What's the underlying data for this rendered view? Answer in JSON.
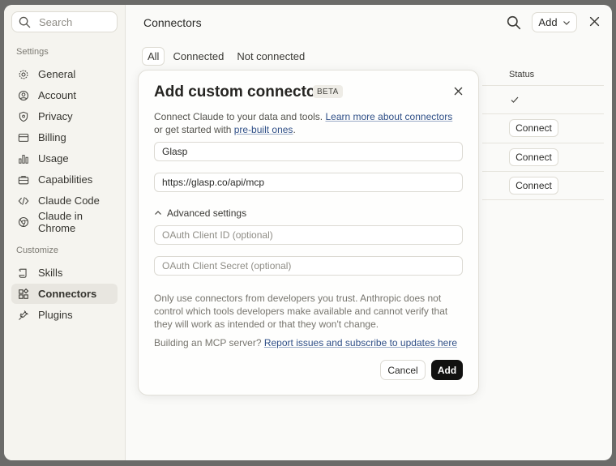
{
  "sidebar": {
    "search_placeholder": "Search",
    "settings_heading": "Settings",
    "settings_items": [
      {
        "label": "General",
        "icon": "gear-icon"
      },
      {
        "label": "Account",
        "icon": "user-circle-icon"
      },
      {
        "label": "Privacy",
        "icon": "shield-icon"
      },
      {
        "label": "Billing",
        "icon": "credit-card-icon"
      },
      {
        "label": "Usage",
        "icon": "bar-chart-icon"
      },
      {
        "label": "Capabilities",
        "icon": "briefcase-icon"
      },
      {
        "label": "Claude Code",
        "icon": "code-icon"
      },
      {
        "label": "Claude in Chrome",
        "icon": "globe-icon"
      }
    ],
    "customize_heading": "Customize",
    "customize_items": [
      {
        "label": "Skills",
        "icon": "scroll-icon"
      },
      {
        "label": "Connectors",
        "icon": "blocks-icon",
        "active": true
      },
      {
        "label": "Plugins",
        "icon": "plug-icon"
      }
    ]
  },
  "main": {
    "title": "Connectors",
    "add_label": "Add",
    "tabs": [
      {
        "label": "All",
        "active": true
      },
      {
        "label": "Connected"
      },
      {
        "label": "Not connected"
      }
    ],
    "status_header": "Status",
    "connect_label": "Connect"
  },
  "modal": {
    "title": "Add custom connector",
    "badge": "BETA",
    "desc_prefix": "Connect Claude to your data and tools. ",
    "desc_link1": "Learn more about connectors",
    "desc_mid": " or get started with ",
    "desc_link2": "pre-built ones",
    "desc_suffix": ".",
    "name_value": "Glasp",
    "url_value": "https://glasp.co/api/mcp",
    "advanced_label": "Advanced settings",
    "client_id_placeholder": "OAuth Client ID (optional)",
    "client_secret_placeholder": "OAuth Client Secret (optional)",
    "warning": "Only use connectors from developers you trust. Anthropic does not control which tools developers make available and cannot verify that they will work as intended or that they won't change.",
    "build_prefix": "Building an MCP server? ",
    "build_link": "Report issues and subscribe to updates here",
    "cancel_label": "Cancel",
    "add_label": "Add"
  },
  "colors": {
    "primary_button": "#111110",
    "link": "#2f4f87",
    "sidebar_bg": "#f5f4ef"
  }
}
